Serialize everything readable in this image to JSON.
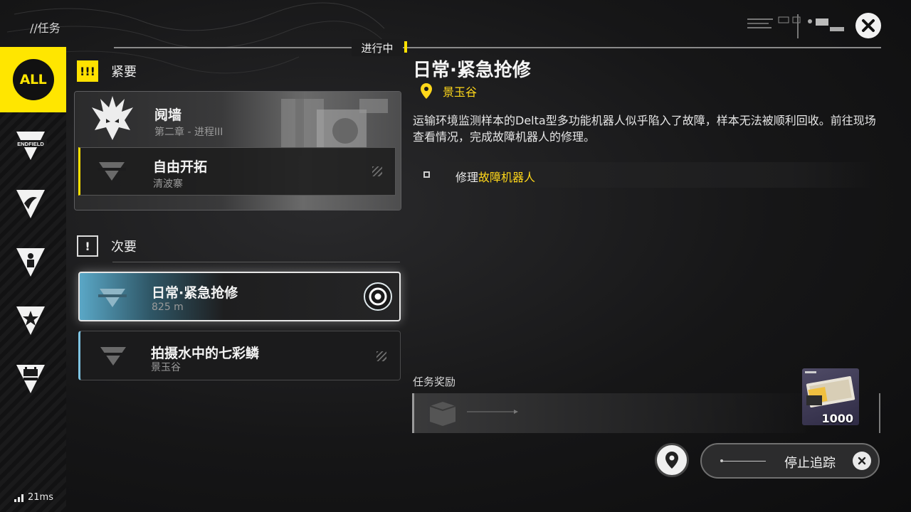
{
  "header": {
    "breadcrumb": "//任务",
    "status_tab": "进行中",
    "close_icon": "close-icon"
  },
  "sidebar": {
    "all_label": "ALL",
    "categories": [
      "endfield-icon",
      "explore-icon",
      "character-icon",
      "star-icon",
      "event-icon"
    ],
    "endfield_caption": "ENDFIELD",
    "accent": "#ffe600"
  },
  "sections": {
    "urgent": {
      "icon": "!!!",
      "label": "紧要"
    },
    "secondary": {
      "icon": "!",
      "label": "次要"
    }
  },
  "urgent_quests": [
    {
      "title": "阋墙",
      "subtitle": "第二章 - 进程III"
    },
    {
      "title": "自由开拓",
      "subtitle": "清波寨"
    }
  ],
  "secondary_quests": [
    {
      "title": "日常·紧急抢修",
      "subtitle": "825 m",
      "tracking": true
    },
    {
      "title": "拍摄水中的七彩鳞",
      "subtitle": "景玉谷"
    }
  ],
  "detail": {
    "title": "日常·紧急抢修",
    "location": "景玉谷",
    "description": "运输环境监测样本的Delta型多功能机器人似乎陷入了故障，样本无法被顺利回收。前往现场查看情况，完成故障机器人的修理。",
    "objective_prefix": "修理",
    "objective_highlight": "故障机器人",
    "reward_label": "任务奖励",
    "reward_quantity": "1000",
    "highlight_color": "#ffd71a"
  },
  "actions": {
    "stop_tracking": "停止追踪",
    "map_icon": "map-pin-icon"
  },
  "status_bar": {
    "ping": "21ms"
  }
}
